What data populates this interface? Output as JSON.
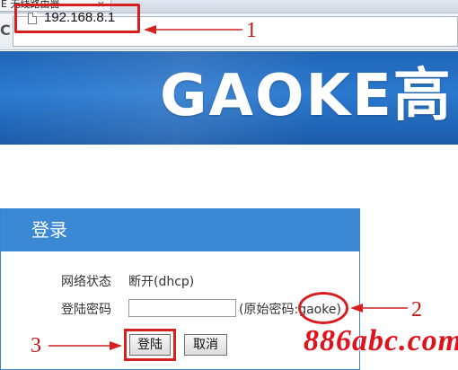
{
  "browser": {
    "tab_title": "E 无线路由器",
    "tab_close": "×",
    "reload_glyph": "C",
    "url": "192.168.8.1"
  },
  "annotations": {
    "n1": "1",
    "n2": "2",
    "n3": "3",
    "accent": "#d62020"
  },
  "banner": {
    "brand_text": "GAOKE高",
    "color": "#2b7ad0"
  },
  "login": {
    "title": "登录",
    "status_label": "网络状态",
    "status_value": "断开(dhcp)",
    "password_label": "登陆密码",
    "password_value": "",
    "password_hint_prefix": "(原始密码:",
    "password_hint_value": "gaoke",
    "password_hint_suffix": ")",
    "login_button": "登陆",
    "cancel_button": "取消",
    "header_color": "#3b89d4"
  },
  "watermark": "886abc.com"
}
